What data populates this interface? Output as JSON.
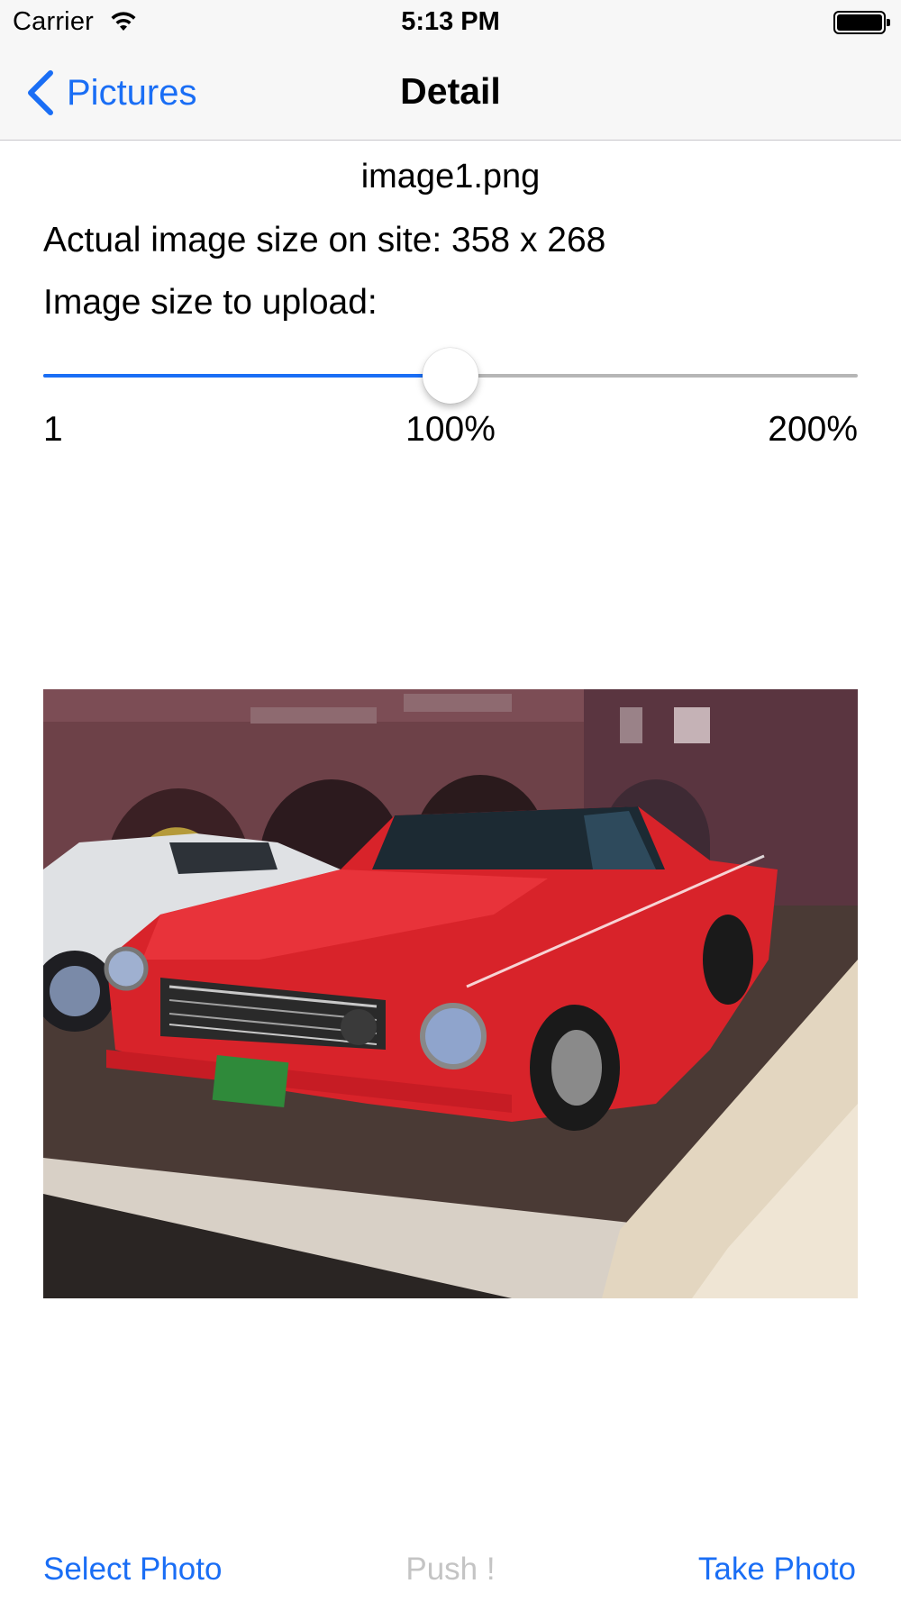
{
  "status_bar": {
    "carrier": "Carrier",
    "time": "5:13 PM",
    "icons": [
      "wifi-icon",
      "battery-icon"
    ]
  },
  "nav": {
    "back_label": "Pictures",
    "back_icon": "chevron-left-icon",
    "title": "Detail",
    "accent": "#1a6ef5"
  },
  "detail": {
    "filename": "image1.png",
    "actual_size": "Actual image size on site: 358 x 268",
    "upload_label": "Image size to upload:",
    "slider": {
      "value_fraction": 0.5,
      "min_label": "1",
      "mid_label": "100%",
      "max_label": "200%"
    },
    "photo_subject": "red-car-photo"
  },
  "toolbar": {
    "select_photo": "Select Photo",
    "push": "Push !",
    "take_photo": "Take Photo",
    "disabled_color": "#c4c4c4"
  }
}
